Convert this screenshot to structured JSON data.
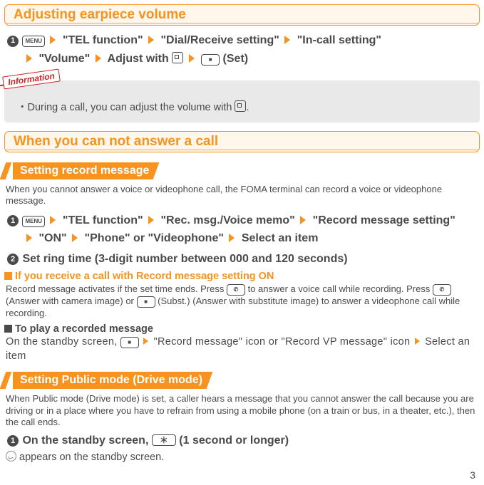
{
  "headers": {
    "adjusting": "Adjusting earpiece volume",
    "cannot_answer": "When you can not answer a call"
  },
  "keys": {
    "menu": "MENU",
    "stop_square": "■",
    "star": "＊",
    "call": "✆"
  },
  "labels": {
    "set_suffix": " (Set)",
    "info_tag": "Information",
    "one_sec": " (1 second or longer)"
  },
  "earpiece_path": {
    "tel_function": "\"TEL function\"",
    "dial_receive": "\"Dial/Receive setting\"",
    "in_call": "\"In-call setting\"",
    "volume": "\"Volume\"",
    "adjust_with": "Adjust with "
  },
  "info_note": "・During a call, you can adjust the volume with ",
  "info_note_end": ".",
  "sections": {
    "record_msg": "Setting record message",
    "public_mode": "Setting Public mode (Drive mode)"
  },
  "record": {
    "intro": "When you cannot answer a voice or videophone call, the FOMA terminal can record a voice or videophone message.",
    "path": {
      "tel_function": "\"TEL function\"",
      "rec_msg": "\"Rec. msg./Voice memo\"",
      "record_setting": "\"Record message setting\"",
      "on": "\"ON\"",
      "phone_vid": "\"Phone\" or \"Videophone\"",
      "select_item": "Select an item"
    },
    "step2": "Set ring time (3-digit number between 000 and 120 seconds)",
    "incoming_header": "If you receive a call with Record message setting ON",
    "incoming_body_1": "Record message activates if the set time ends. Press ",
    "incoming_body_2": " to answer a voice call while recording. Press ",
    "incoming_body_3": " (Answer with camera image) or ",
    "incoming_body_4": " (Subst.) (Answer with substitute image) to answer a videophone call while recording.",
    "play_header": "To play a recorded message",
    "play_body_1": "On the standby screen, ",
    "play_body_2": "\"Record message\" icon or \"Record VP message\" icon",
    "play_body_3": "Select an item"
  },
  "public": {
    "intro": "When Public mode (Drive mode) is set, a caller hears a message that you cannot answer the call because you are driving or in a place where you have to refrain from using a mobile phone (on a train or bus, in a theater, etc.), then the call ends.",
    "step_prefix": "On the standby screen, ",
    "appears": " appears on the standby screen."
  },
  "page_number": "3"
}
